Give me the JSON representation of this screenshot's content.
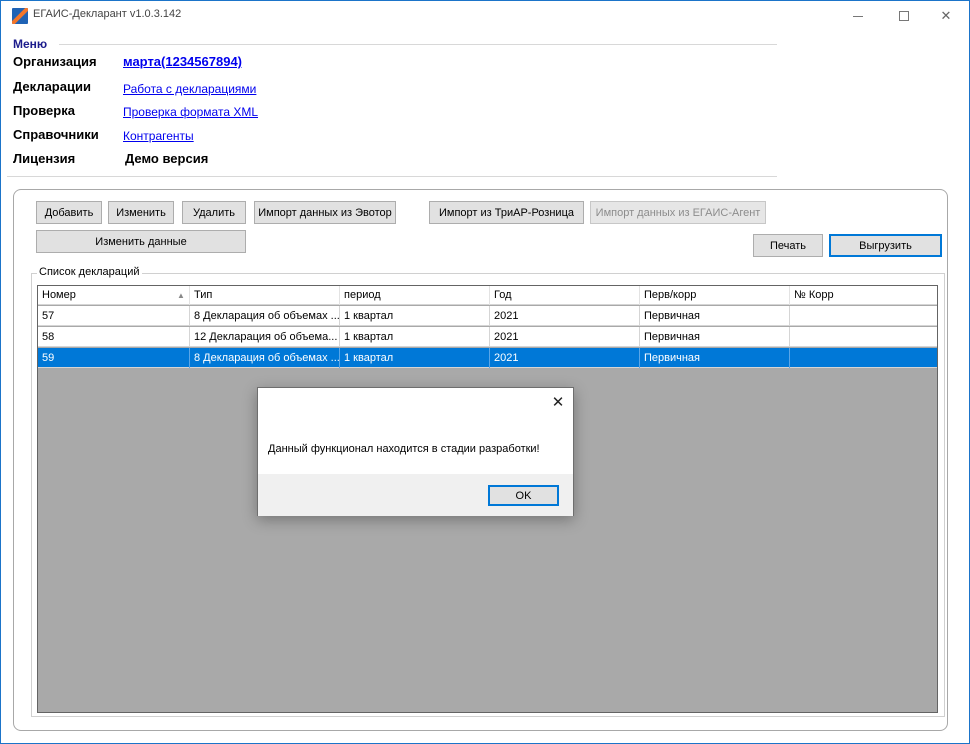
{
  "window": {
    "title": "ЕГАИС-Декларант v1.0.3.142",
    "controls": {
      "minimize": "—",
      "maximize": "□",
      "close": "✕"
    }
  },
  "menu": {
    "title": "Меню",
    "organization": {
      "label": "Организация",
      "value": "марта(1234567894)"
    },
    "declarations": {
      "label": "Декларации",
      "link": "Работа с декларациями"
    },
    "check": {
      "label": "Проверка",
      "link": "Проверка формата XML"
    },
    "references": {
      "label": "Справочники",
      "link": "Контрагенты"
    },
    "license": {
      "label": "Лицензия",
      "value": "Демо версия"
    }
  },
  "toolbar": {
    "add": "Добавить",
    "edit": "Изменить",
    "delete": "Удалить",
    "import_evotor": "Импорт данных из Эвотор",
    "import_triar": "Импорт из ТриАР-Розница",
    "import_egais_agent": "Импорт данных из ЕГАИС-Агент",
    "change_data": "Изменить данные",
    "print": "Печать",
    "export": "Выгрузить"
  },
  "declarations_list": {
    "caption": "Список деклараций",
    "columns": [
      "Номер",
      "Тип",
      "период",
      "Год",
      "Перв/корр",
      "№ Корр"
    ],
    "rows": [
      {
        "number": "57",
        "type": "8 Декларация об объемах ...",
        "period": "1 квартал",
        "year": "2021",
        "kind": "Первичная",
        "corr_no": ""
      },
      {
        "number": "58",
        "type": "12 Декларация об объема...",
        "period": "1 квартал",
        "year": "2021",
        "kind": "Первичная",
        "corr_no": ""
      },
      {
        "number": "59",
        "type": "8 Декларация об объемах ...",
        "period": "1 квартал",
        "year": "2021",
        "kind": "Первичная",
        "corr_no": ""
      }
    ],
    "selected_row": 2
  },
  "dialog": {
    "message": "Данный функционал находится в стадии разработки!",
    "ok": "OK",
    "close": "✕"
  },
  "colors": {
    "accent": "#0078d7",
    "link": "#0000ee",
    "grid_background": "#a9a9a9",
    "menu_title": "#1c1c8c"
  }
}
